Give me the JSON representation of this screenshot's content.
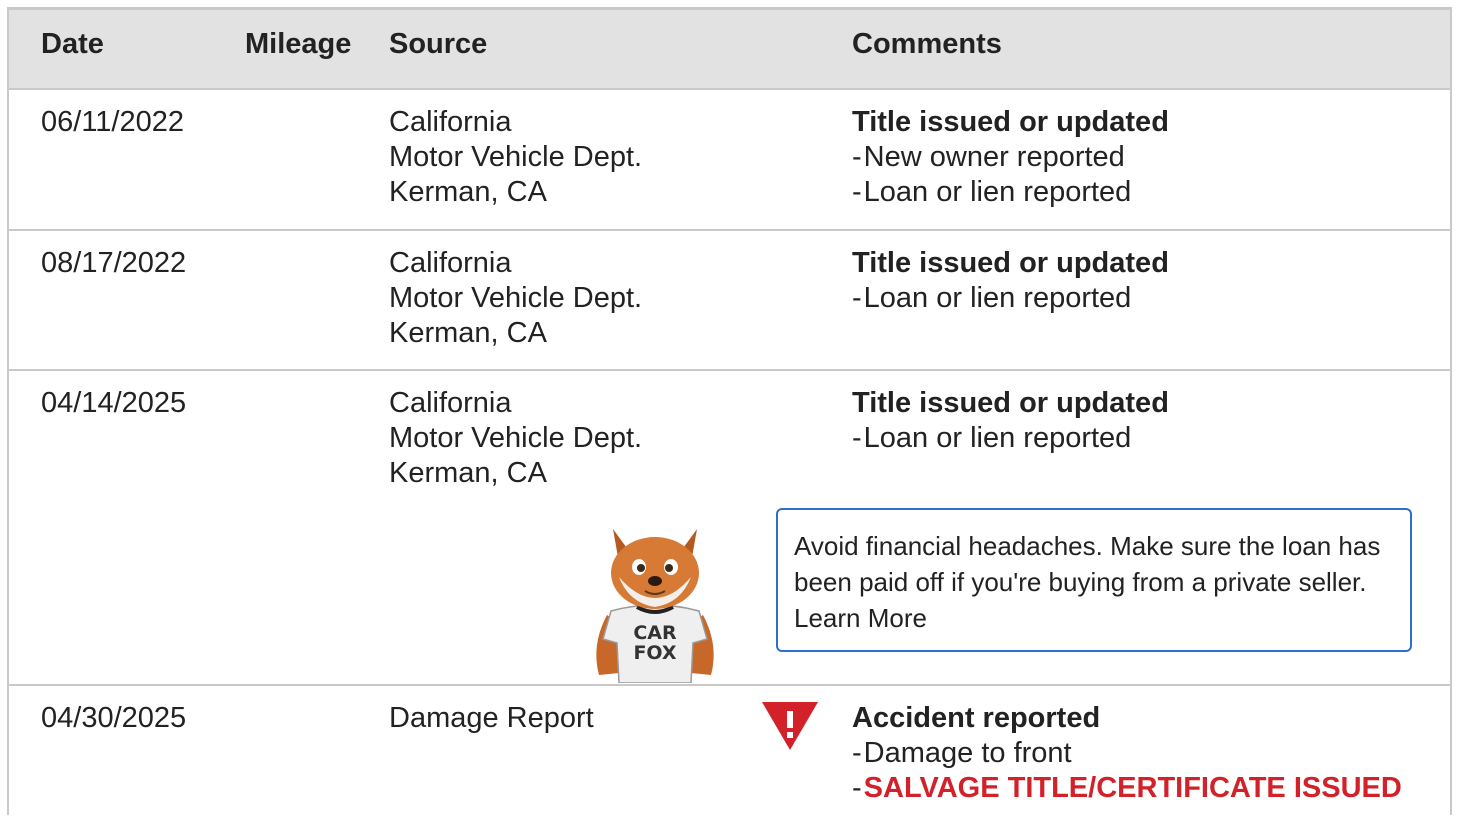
{
  "headers": {
    "date": "Date",
    "mileage": "Mileage",
    "source": "Source",
    "comments": "Comments"
  },
  "rows": [
    {
      "date": "06/11/2022",
      "mileage": "",
      "source": [
        "California",
        "Motor Vehicle Dept.",
        "Kerman, CA"
      ],
      "title": "Title issued or updated",
      "details": [
        "New owner reported",
        "Loan or lien reported"
      ]
    },
    {
      "date": "08/17/2022",
      "mileage": "",
      "source": [
        "California",
        "Motor Vehicle Dept.",
        "Kerman, CA"
      ],
      "title": "Title issued or updated",
      "details": [
        "Loan or lien reported"
      ]
    },
    {
      "date": "04/14/2025",
      "mileage": "",
      "source": [
        "California",
        "Motor Vehicle Dept.",
        "Kerman, CA"
      ],
      "title": "Title issued or updated",
      "details": [
        "Loan or lien reported"
      ]
    },
    {
      "date": "04/30/2025",
      "mileage": "",
      "source": [
        "Damage Report"
      ],
      "title": "Accident reported",
      "details": [
        "Damage to front"
      ],
      "alert": "SALVAGE TITLE/CERTIFICATE ISSUED"
    }
  ],
  "tip": {
    "text": "Avoid financial headaches. Make sure the loan has been paid off if you're buying from a private seller.",
    "link": "Learn More"
  },
  "mascot": {
    "shirt_line1": "CAR",
    "shirt_line2": "FOX"
  },
  "dash": "-",
  "colors": {
    "header_bg": "#e2e2e2",
    "border": "#c9c9c9",
    "alert_red": "#d3212a",
    "tip_border": "#2e6fc9"
  },
  "icons": {
    "warning": "warning-triangle-icon",
    "mascot": "carfox-mascot"
  }
}
